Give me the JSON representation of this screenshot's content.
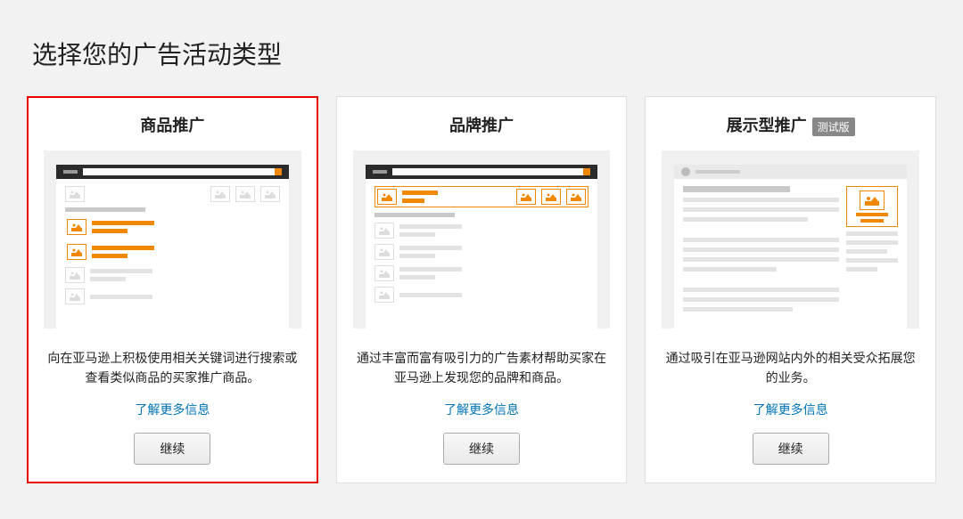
{
  "page": {
    "heading": "选择您的广告活动类型"
  },
  "cards": [
    {
      "title": "商品推广",
      "badge": null,
      "description": "向在亚马逊上积极使用相关关键词进行搜索或查看类似商品的买家推广商品。",
      "learn_more": "了解更多信息",
      "continue": "继续",
      "selected": true
    },
    {
      "title": "品牌推广",
      "badge": null,
      "description": "通过丰富而富有吸引力的广告素材帮助买家在亚马逊上发现您的品牌和商品。",
      "learn_more": "了解更多信息",
      "continue": "继续",
      "selected": false
    },
    {
      "title": "展示型推广",
      "badge": "测试版",
      "description": "通过吸引在亚马逊网站内外的相关受众拓展您的业务。",
      "learn_more": "了解更多信息",
      "continue": "继续",
      "selected": false
    }
  ]
}
